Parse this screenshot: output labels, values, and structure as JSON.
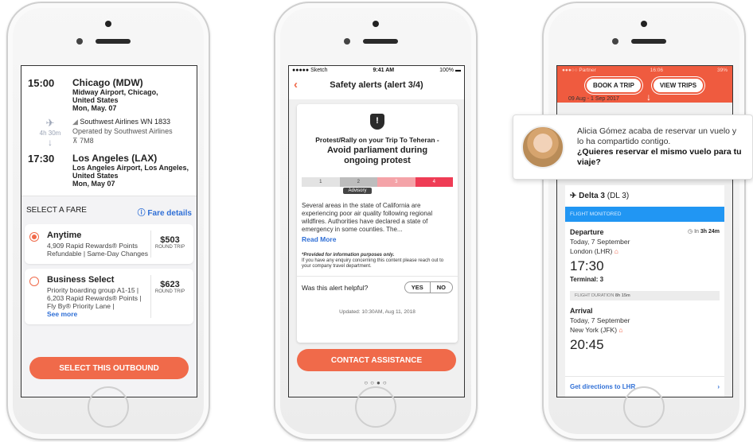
{
  "phone1": {
    "depart": {
      "time": "15:00",
      "city": "Chicago (MDW)",
      "airport": "Midway Airport, Chicago, United States",
      "date": "Mon, May. 07"
    },
    "duration": "4h 30m",
    "airline": "Southwest Airlines WN 1833",
    "operated": "Operated by Southwest Airlines",
    "aircraft": "7M8",
    "arrive": {
      "time": "17:30",
      "city": "Los Angeles (LAX)",
      "airport": "Los Angeles Airport, Los Angeles, United States",
      "date": "Mon, May  07"
    },
    "select_fare_label": "SELECT A FARE",
    "fare_details_label": "Fare details",
    "fares": [
      {
        "name": "Anytime",
        "desc": "4,909 Rapid Rewards® Points Refundable | Same-Day Changes",
        "price": "$503",
        "trip": "ROUND TRIP",
        "selected": true
      },
      {
        "name": "Business Select",
        "desc": "Priority boarding group A1-15 | 6,203 Rapid Rewards® Points | Fly By® Priority Lane |",
        "more": "See more",
        "price": "$623",
        "trip": "ROUND TRIP",
        "selected": false
      }
    ],
    "cta": "SELECT THIS OUTBOUND"
  },
  "phone2": {
    "status": {
      "carrier": "●●●●● Sketch",
      "time": "9:41 AM",
      "battery": "100%"
    },
    "title": "Safety alerts (alert 3/4)",
    "kicker": "Protest/Rally on your Trip To Teheran -",
    "headline": "Avoid parliament during ongoing protest",
    "levels": [
      "1",
      "2",
      "3",
      "4"
    ],
    "level_tag": "Advisory",
    "body": "Several areas in the state of California are experiencing poor air quality following regional wildfires. Authorities have declared a state of emergency in some counties. The...",
    "read_more": "Read More",
    "note_bold": "*Provided for information purposes only.",
    "note": "If you have any enquiry concerning this content please reach out to your company travel department.",
    "helpful_q": "Was this alert helpful?",
    "yes": "YES",
    "no": "NO",
    "updated": "Updated: 10:30AM, Aug 11, 2018",
    "cta": "CONTACT ASSISTANCE",
    "dots": "○○●○"
  },
  "phone3": {
    "status": {
      "carrier": "●●●○○ Partner",
      "time": "16:06",
      "battery": "39%"
    },
    "book": "BOOK A TRIP",
    "view": "VIEW TRIPS",
    "date_range": "09 Aug - 1 Sep 2017",
    "flight": "Delta 3",
    "flight_code": "(DL 3)",
    "monitored": "FLIGHT MONITORED",
    "departure": {
      "label": "Departure",
      "in": "In",
      "in_value": "3h 24m",
      "date": "Today, 7 September",
      "airport": "London (LHR)",
      "time": "17:30",
      "terminal": "Terminal: 3"
    },
    "duration_label": "FLIGHT DURATION",
    "duration_value": "8h 15m",
    "arrival": {
      "label": "Arrival",
      "date": "Today, 7 September",
      "airport": "New York (JFK)",
      "time": "20:45"
    },
    "directions": "Get directions to LHR",
    "directions_chevron": "›"
  },
  "notification": {
    "line1": "Alicia Gómez  acaba de reservar un vuelo y lo ha compartido  contigo.",
    "question": "¿Quieres reservar el mismo vuelo para tu viaje?"
  },
  "colors": {
    "accent": "#ef5b3f",
    "link": "#2f6fd6",
    "monitored": "#2196f3"
  },
  "icons": [
    "plane-icon",
    "info-icon",
    "back-chevron-icon",
    "shield-alert-icon",
    "timer-icon",
    "seat-icon"
  ]
}
